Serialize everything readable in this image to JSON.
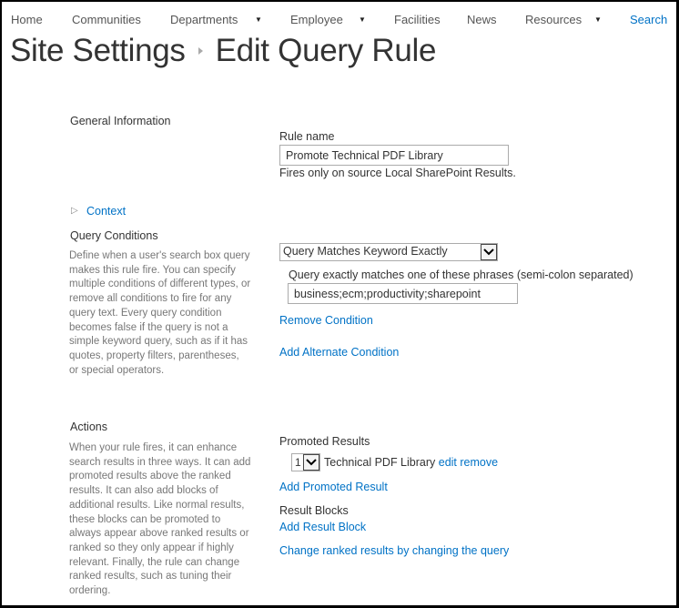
{
  "nav": {
    "items": [
      {
        "label": "Home",
        "has_menu": false
      },
      {
        "label": "Communities",
        "has_menu": false
      },
      {
        "label": "Departments",
        "has_menu": true
      },
      {
        "label": "Employee",
        "has_menu": true
      },
      {
        "label": "Facilities",
        "has_menu": false
      },
      {
        "label": "News",
        "has_menu": false
      },
      {
        "label": "Resources",
        "has_menu": true
      }
    ],
    "search_label": "Search"
  },
  "breadcrumb": {
    "parent": "Site Settings",
    "current": "Edit Query Rule"
  },
  "general": {
    "heading": "General Information",
    "rule_name_label": "Rule name",
    "rule_name_value": "Promote Technical PDF Library",
    "source_note": "Fires only on source Local SharePoint Results."
  },
  "context": {
    "label": "Context"
  },
  "query_conditions": {
    "heading": "Query Conditions",
    "description": "Define when a user's search box query makes this rule fire. You can specify multiple conditions of different types, or remove all conditions to fire for any query text. Every query condition becomes false if the query is not a simple keyword query, such as if it has quotes, property filters, parentheses, or special operators.",
    "condition_type": "Query Matches Keyword Exactly",
    "phrases_label": "Query exactly matches one of these phrases (semi-colon separated)",
    "phrases_value": "business;ecm;productivity;sharepoint",
    "remove_condition": "Remove Condition",
    "add_alternate": "Add Alternate Condition"
  },
  "actions": {
    "heading": "Actions",
    "description": "When your rule fires, it can enhance search results in three ways. It can add promoted results above the ranked results. It can also add blocks of additional results. Like normal results, these blocks can be promoted to always appear above ranked results or ranked so they only appear if highly relevant. Finally, the rule can change ranked results, such as tuning their ordering.",
    "promoted_results_label": "Promoted Results",
    "promoted_items": [
      {
        "order": "1",
        "title": "Technical PDF Library",
        "edit": "edit",
        "remove": "remove"
      }
    ],
    "add_promoted_result": "Add Promoted Result",
    "result_blocks_label": "Result Blocks",
    "add_result_block": "Add Result Block",
    "change_ranked": "Change ranked results by changing the query"
  },
  "colors": {
    "link": "#0072c6",
    "text": "#333333",
    "muted": "#777777"
  }
}
